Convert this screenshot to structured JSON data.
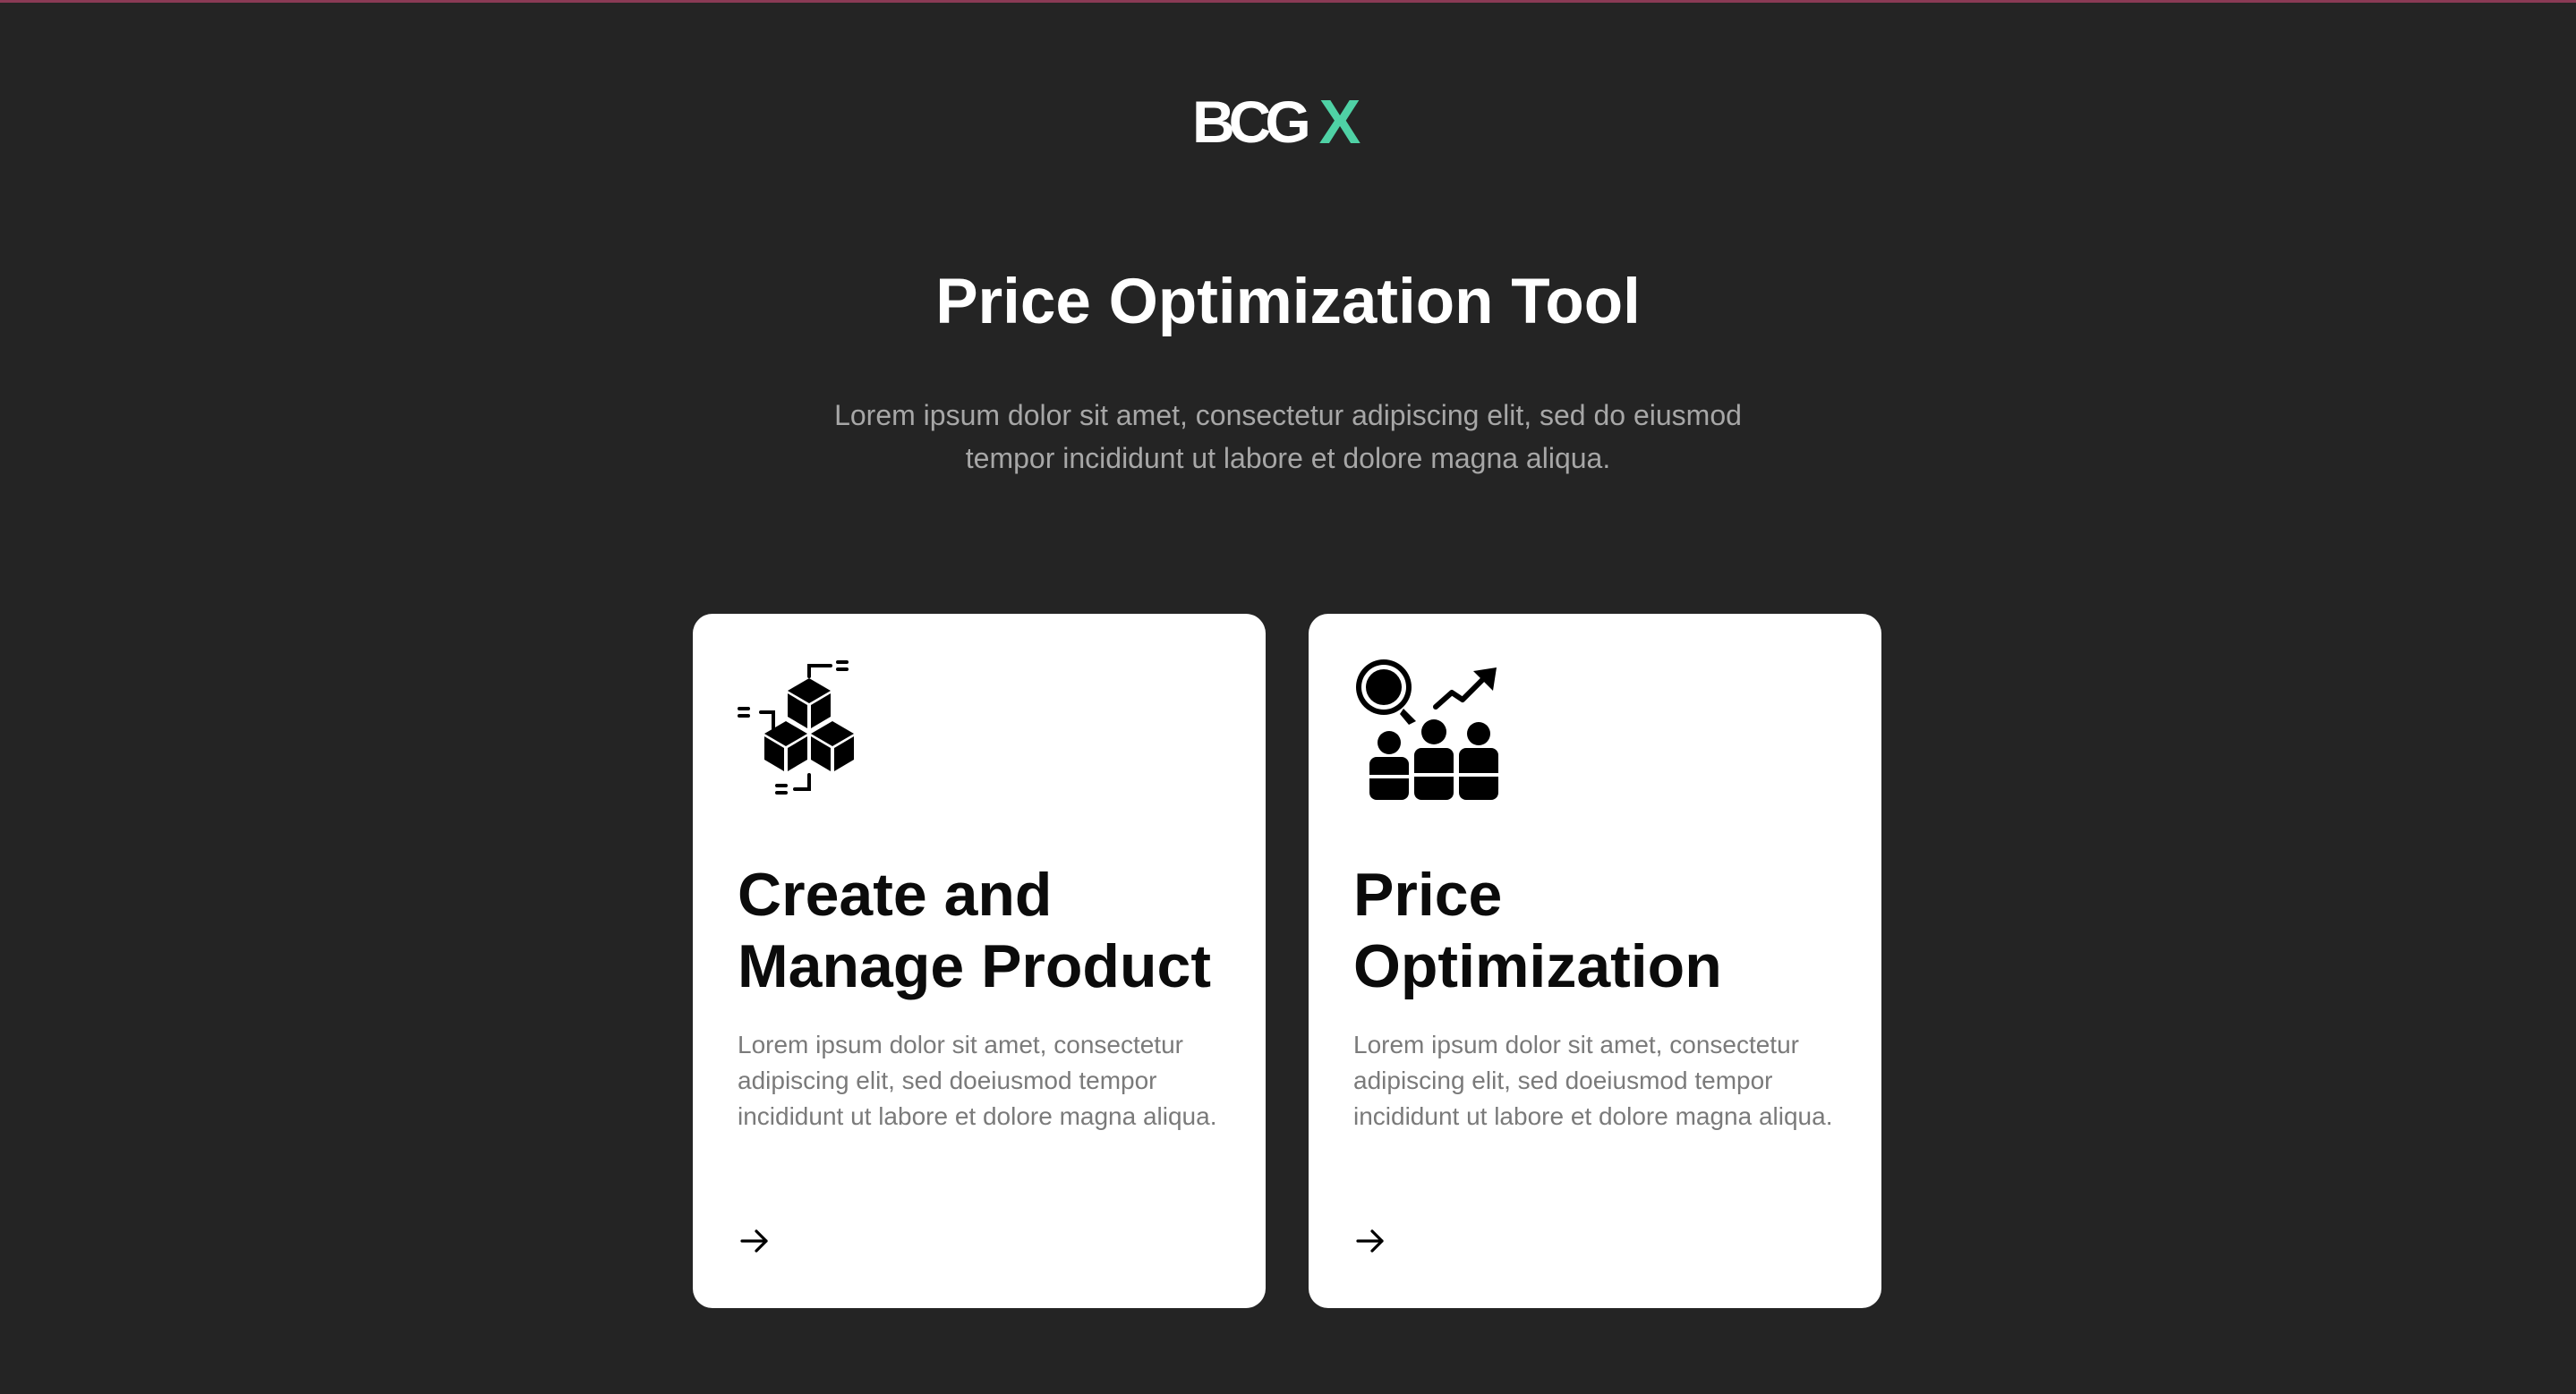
{
  "brand": {
    "logo_main": "BCG",
    "logo_accent": "X",
    "accent_color": "#4fd1a5"
  },
  "hero": {
    "title": "Price Optimization Tool",
    "subtitle": "Lorem ipsum dolor sit amet, consectetur adipiscing elit, sed do eiusmod tempor incididunt ut labore et dolore magna aliqua."
  },
  "cards": [
    {
      "icon": "cubes-icon",
      "title": "Create and Manage Product",
      "description": "Lorem ipsum dolor sit amet, consectetur adipiscing elit, sed doeiusmod tempor incididunt ut labore et dolore magna aliqua.",
      "action_icon": "arrow-right-icon"
    },
    {
      "icon": "analytics-people-icon",
      "title": "Price Optimization",
      "description": "Lorem ipsum dolor sit amet, consectetur adipiscing elit, sed doeiusmod tempor incididunt ut labore et dolore magna aliqua.",
      "action_icon": "arrow-right-icon"
    }
  ]
}
